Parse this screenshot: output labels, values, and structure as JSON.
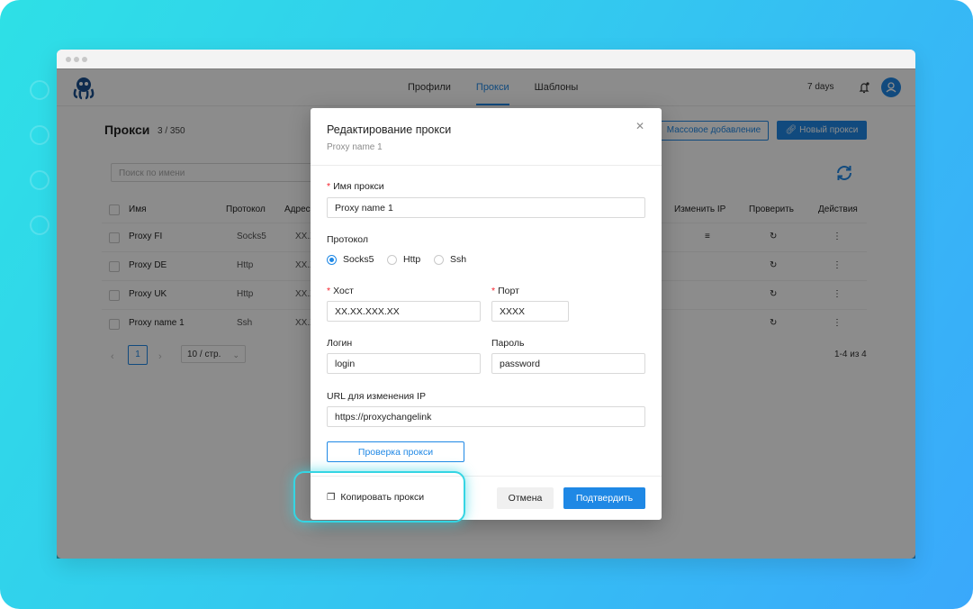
{
  "header": {
    "nav": [
      "Профили",
      "Прокси",
      "Шаблоны"
    ],
    "active_nav": "Прокси",
    "days": "7 days"
  },
  "page": {
    "title": "Прокси",
    "count": "3 / 350",
    "mass_add_label": "Массовое добавление",
    "new_proxy_label": "Новый прокси",
    "search_placeholder": "Поиск по имени"
  },
  "table": {
    "columns": [
      "Имя",
      "Протокол",
      "Адрес",
      "Изменить IP",
      "Проверить",
      "Действия"
    ],
    "rows": [
      {
        "name": "Proxy FI",
        "protocol": "Socks5",
        "address": "XX.X"
      },
      {
        "name": "Proxy DE",
        "protocol": "Http",
        "address": "XX.X"
      },
      {
        "name": "Proxy UK",
        "protocol": "Http",
        "address": "XX.X"
      },
      {
        "name": "Proxy name 1",
        "protocol": "Ssh",
        "address": "XX.X"
      }
    ]
  },
  "pagination": {
    "current": "1",
    "page_size": "10 / стр.",
    "total": "1-4 из 4"
  },
  "modal": {
    "title": "Редактирование прокси",
    "subtitle": "Proxy name 1",
    "name_label": "Имя прокси",
    "name_value": "Proxy name 1",
    "protocol_label": "Протокол",
    "protocols": [
      "Socks5",
      "Http",
      "Ssh"
    ],
    "selected_protocol": "Socks5",
    "host_label": "Хост",
    "host_value": "XX.XX.XXX.XX",
    "port_label": "Порт",
    "port_value": "XXXX",
    "login_label": "Логин",
    "login_value": "login",
    "password_label": "Пароль",
    "password_value": "password",
    "url_label": "URL для изменения IP",
    "url_value": "https://proxychangelink",
    "check_button": "Проверка прокси",
    "copy_label": "Копировать прокси",
    "cancel_label": "Отмена",
    "confirm_label": "Подтвердить"
  },
  "colors": {
    "accent": "#1f88e5",
    "required": "#f5222d",
    "highlight": "#35d5e3"
  }
}
